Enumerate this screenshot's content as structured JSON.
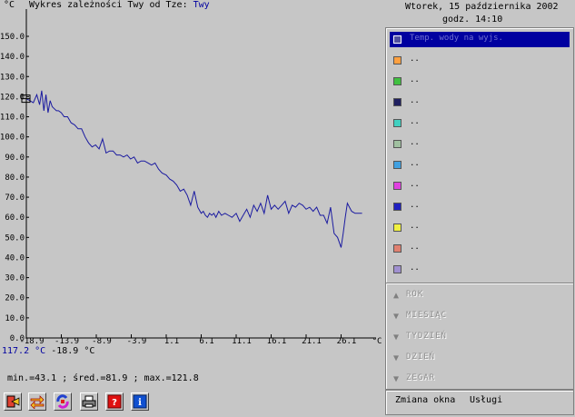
{
  "header": {
    "title_prefix": "Wykres zależności Twy od Tze:",
    "title_series": "Twy",
    "unit_y": "°C",
    "unit_x": "°C",
    "date": "Wtorek, 15 października 2002",
    "time": "godz. 14:10"
  },
  "chart_data": {
    "type": "line",
    "xlabel": "°C",
    "ylabel": "°C",
    "y_ticks": [
      "0.0",
      "10.0",
      "20.0",
      "30.0",
      "40.0",
      "50.0",
      "60.0",
      "70.0",
      "80.0",
      "90.0",
      "100.0",
      "110.0",
      "120.0",
      "130.0",
      "140.0",
      "150.0"
    ],
    "y_tick_values": [
      0,
      10,
      20,
      30,
      40,
      50,
      60,
      70,
      80,
      90,
      100,
      110,
      120,
      130,
      140,
      150
    ],
    "x_ticks": [
      "-18.9",
      "-13.9",
      "-8.9",
      "-3.9",
      "1.1",
      "6.1",
      "11.1",
      "16.1",
      "21.1",
      "26.1"
    ],
    "x_tick_values": [
      -18.9,
      -13.9,
      -8.9,
      -3.9,
      1.1,
      6.1,
      11.1,
      16.1,
      21.1,
      26.1
    ],
    "xlim": [
      -18.9,
      31.1
    ],
    "ylim": [
      0,
      150
    ],
    "grid": false,
    "series": [
      {
        "name": "Twy",
        "color": "#1a1aa0",
        "x": [
          -18.9,
          -18.4,
          -17.9,
          -17.4,
          -17.0,
          -16.7,
          -16.4,
          -16.1,
          -15.8,
          -15.5,
          -15.2,
          -14.9,
          -14.6,
          -14.3,
          -13.9,
          -13.5,
          -13.0,
          -12.5,
          -12.0,
          -11.5,
          -11.0,
          -10.5,
          -10.0,
          -9.5,
          -9.0,
          -8.5,
          -8.0,
          -7.5,
          -7.0,
          -6.5,
          -6.0,
          -5.5,
          -5.0,
          -4.5,
          -4.0,
          -3.5,
          -3.0,
          -2.5,
          -2.0,
          -1.5,
          -1.0,
          -0.5,
          0.0,
          0.5,
          1.1,
          1.6,
          2.1,
          2.6,
          3.1,
          3.6,
          4.1,
          4.6,
          5.1,
          5.6,
          6.1,
          6.4,
          6.7,
          7.0,
          7.3,
          7.6,
          7.9,
          8.2,
          8.6,
          9.0,
          9.5,
          10.0,
          10.5,
          11.1,
          11.6,
          12.1,
          12.6,
          13.1,
          13.6,
          14.1,
          14.6,
          15.1,
          15.6,
          16.1,
          16.6,
          17.1,
          17.6,
          18.1,
          18.6,
          19.1,
          19.6,
          20.1,
          20.6,
          21.1,
          21.6,
          22.1,
          22.6,
          23.1,
          23.6,
          24.1,
          24.6,
          25.1,
          25.6,
          26.1,
          26.4,
          26.7,
          27.0,
          27.3,
          27.6,
          28.1,
          28.6,
          29.1
        ],
        "y": [
          119,
          118,
          117,
          121,
          116,
          123,
          113,
          121,
          112,
          118,
          115,
          114,
          113,
          113,
          112,
          110,
          110,
          107,
          106,
          104,
          104,
          100,
          97,
          95,
          96,
          94,
          99,
          92,
          93,
          93,
          91,
          91,
          90,
          91,
          89,
          90,
          87,
          88,
          88,
          87,
          86,
          87,
          84,
          82,
          81,
          79,
          78,
          76,
          73,
          74,
          71,
          66,
          73,
          65,
          62,
          63,
          61,
          60,
          62,
          61,
          62,
          60,
          63,
          61,
          62,
          61,
          60,
          62,
          58,
          61,
          64,
          60,
          66,
          63,
          67,
          62,
          71,
          64,
          66,
          64,
          66,
          68,
          62,
          66,
          65,
          67,
          66,
          64,
          65,
          63,
          65,
          61,
          61,
          57,
          65,
          52,
          50,
          45,
          52,
          60,
          67,
          65,
          63,
          62,
          62,
          62
        ]
      }
    ],
    "cursor_readout": {
      "y": "117.2 °C",
      "x": "-18.9 °C"
    },
    "stats": "min.=43.1 ; śred.=81.9 ; max.=121.8"
  },
  "legend": {
    "items": [
      {
        "label": "Temp. wody na wyjs.",
        "color": "#5050a0",
        "selected": true
      },
      {
        "label": "..",
        "color": "#ffa040",
        "selected": false
      },
      {
        "label": "..",
        "color": "#40c040",
        "selected": false
      },
      {
        "label": "..",
        "color": "#202060",
        "selected": false
      },
      {
        "label": "..",
        "color": "#40d0c0",
        "selected": false
      },
      {
        "label": "..",
        "color": "#a0c0a0",
        "selected": false
      },
      {
        "label": "..",
        "color": "#40a0e0",
        "selected": false
      },
      {
        "label": "..",
        "color": "#e040e0",
        "selected": false
      },
      {
        "label": "..",
        "color": "#2020c0",
        "selected": false
      },
      {
        "label": "..",
        "color": "#f0f040",
        "selected": false
      },
      {
        "label": "..",
        "color": "#e08070",
        "selected": false
      },
      {
        "label": "..",
        "color": "#a090d0",
        "selected": false
      }
    ]
  },
  "periods": {
    "items": [
      {
        "label": "ROK",
        "icon": "arrow-up-icon"
      },
      {
        "label": "MIESIĄC",
        "icon": "arrow-down-icon"
      },
      {
        "label": "TYDZIEŃ",
        "icon": "arrow-down-icon"
      },
      {
        "label": "DZIEŃ",
        "icon": "arrow-down-icon"
      },
      {
        "label": "ZEGAR",
        "icon": "arrow-down-icon"
      }
    ]
  },
  "menu": {
    "zmiana_okna": "Zmiana okna",
    "uslugi": "Usługi"
  },
  "toolbar": {
    "buttons": [
      {
        "name": "exit-icon"
      },
      {
        "name": "swap-icon"
      },
      {
        "name": "refresh-icon"
      },
      {
        "name": "print-icon"
      },
      {
        "name": "help-icon"
      },
      {
        "name": "info-icon"
      }
    ]
  }
}
